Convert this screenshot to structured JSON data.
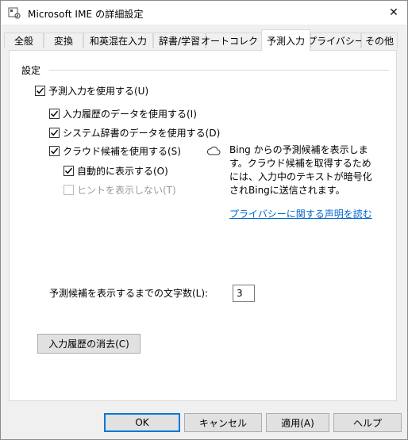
{
  "window": {
    "title": "Microsoft IME の詳細設定",
    "close_symbol": "✕"
  },
  "tabs": [
    {
      "label": "全般"
    },
    {
      "label": "変換"
    },
    {
      "label": "和英混在入力"
    },
    {
      "label": "辞書/学習"
    },
    {
      "label": "オートコレクト"
    },
    {
      "label": "予測入力"
    },
    {
      "label": "プライバシー"
    },
    {
      "label": "その他"
    }
  ],
  "active_tab": "予測入力",
  "settings": {
    "group_label": "設定",
    "use_prediction": {
      "label": "予測入力を使用する(U)",
      "checked": true
    },
    "use_history": {
      "label": "入力履歴のデータを使用する(I)",
      "checked": true
    },
    "use_system_dict": {
      "label": "システム辞書のデータを使用する(D)",
      "checked": true
    },
    "use_cloud": {
      "label": "クラウド候補を使用する(S)",
      "checked": true
    },
    "auto_show": {
      "label": "自動的に表示する(O)",
      "checked": true
    },
    "hide_hint": {
      "label": "ヒントを表示しない(T)",
      "checked": false,
      "disabled": true
    },
    "bing_description": "Bing からの予測候補を表示します。クラウド候補を取得するためには、入力中のテキストが暗号化されBingに送信されます。",
    "privacy_link": "プライバシーに関する声明を読む",
    "chars_label": "予測候補を表示するまでの文字数(L):",
    "chars_value": "3",
    "clear_history_button": "入力履歴の消去(C)"
  },
  "footer": {
    "ok": "OK",
    "cancel": "キャンセル",
    "apply": "適用(A)",
    "help": "ヘルプ"
  },
  "colors": {
    "link": "#0066cc",
    "default_button_border": "#0078d7"
  }
}
